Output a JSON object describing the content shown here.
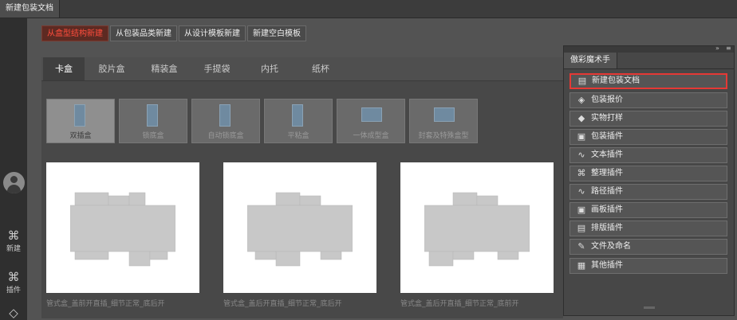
{
  "window": {
    "doc_tab": "新建包装文档"
  },
  "left_bar": {
    "items": [
      {
        "icon": "grid-icon",
        "glyph": "⌘",
        "label": "新建"
      },
      {
        "icon": "plugin-icon",
        "glyph": "⌘",
        "label": "插件"
      }
    ]
  },
  "toolbar": {
    "buttons": [
      "从盒型结构新建",
      "从包装品类新建",
      "从设计模板新建",
      "新建空白模板"
    ],
    "active_index": 0,
    "active_color": "#ff4d3d"
  },
  "category_tabs": [
    "卡盒",
    "胶片盒",
    "精装盒",
    "手提袋",
    "内托",
    "纸杯"
  ],
  "box_types": [
    "双插盒",
    "锁底盒",
    "自动锁底盒",
    "平粘盒",
    "一体成型盒",
    "封套及特殊盒型"
  ],
  "templates": [
    "管式盒_盖前开直插_细节正常_底后开",
    "管式盒_盖后开直插_细节正常_底后开",
    "管式盒_盖后开直插_细节正常_底前开"
  ],
  "side_panel": {
    "title": "傲彩魔术手",
    "items": [
      {
        "icon": "new-document-icon",
        "glyph": "▤",
        "label": "新建包装文档"
      },
      {
        "icon": "package-quote-icon",
        "glyph": "◈",
        "label": "包装报价"
      },
      {
        "icon": "proof-print-icon",
        "glyph": "◆",
        "label": "实物打样"
      },
      {
        "icon": "package-plugin-icon",
        "glyph": "▣",
        "label": "包装插件"
      },
      {
        "icon": "text-plugin-icon",
        "glyph": "∿",
        "label": "文本插件"
      },
      {
        "icon": "grid-plugin-icon",
        "glyph": "⌘",
        "label": "整理插件"
      },
      {
        "icon": "path-plugin-icon",
        "glyph": "∿",
        "label": "路径插件"
      },
      {
        "icon": "artboard-plugin-icon",
        "glyph": "▣",
        "label": "画板插件"
      },
      {
        "icon": "layout-plugin-icon",
        "glyph": "▤",
        "label": "排版插件"
      },
      {
        "icon": "file-naming-icon",
        "glyph": "✎",
        "label": "文件及命名"
      },
      {
        "icon": "other-plugin-icon",
        "glyph": "▦",
        "label": "其他插件"
      }
    ],
    "highlight_color": "#e53935"
  }
}
